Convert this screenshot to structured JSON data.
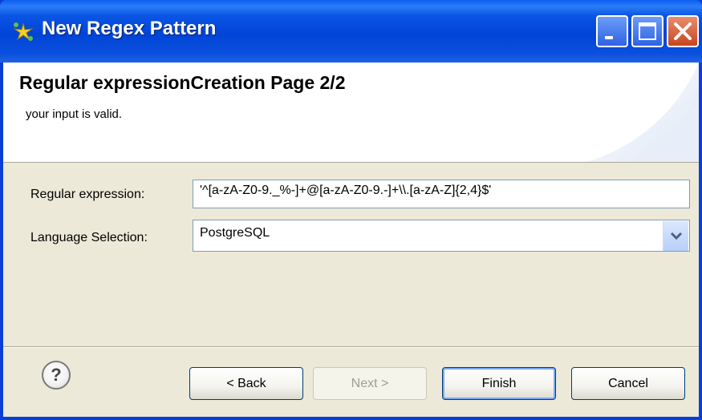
{
  "window": {
    "title": "New Regex Pattern",
    "controls": {
      "minimize": "minimize",
      "maximize": "maximize",
      "close": "close"
    }
  },
  "header": {
    "title": "Regular expressionCreation Page 2/2",
    "message": "your input is valid."
  },
  "form": {
    "regex_label": "Regular expression:",
    "regex_value": "'^[a-zA-Z0-9._%-]+@[a-zA-Z0-9.-]+\\\\.[a-zA-Z]{2,4}$'",
    "language_label": "Language Selection:",
    "language_value": "PostgreSQL"
  },
  "buttons": {
    "help": "?",
    "back": "< Back",
    "next": "Next >",
    "finish": "Finish",
    "cancel": "Cancel"
  },
  "colors": {
    "titlebar": "#0044d8",
    "dialog_bg": "#ece9d8",
    "close_button": "#c94521"
  },
  "icons": [
    "regex-star-icon",
    "minimize-icon",
    "maximize-icon",
    "close-icon",
    "help-icon",
    "chevron-down-icon"
  ]
}
